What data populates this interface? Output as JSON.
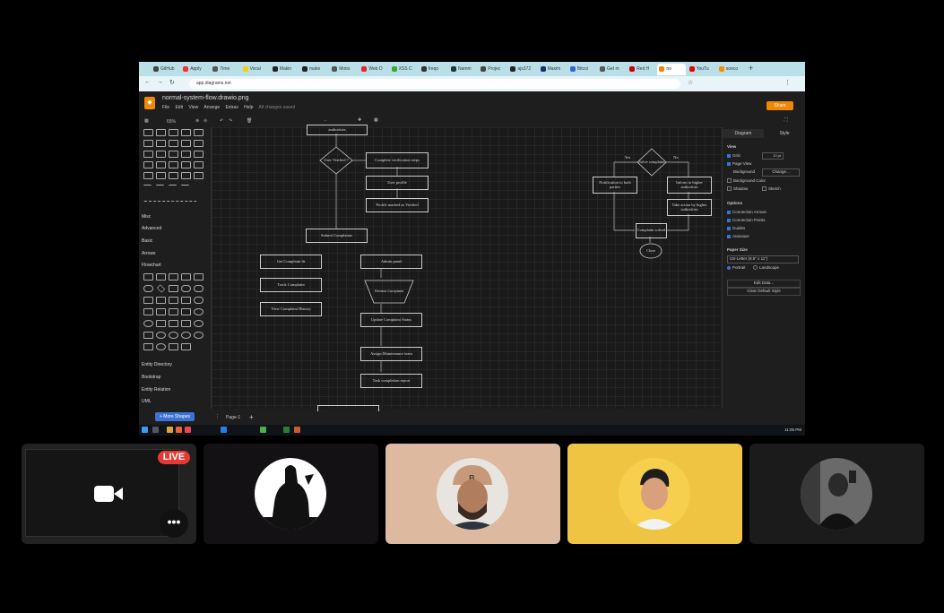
{
  "browser": {
    "tabs": [
      {
        "label": "GitHub",
        "color": "#444"
      },
      {
        "label": "Apply",
        "color": "#e33"
      },
      {
        "label": "Time",
        "color": "#555"
      },
      {
        "label": "Vocal",
        "color": "#fc0"
      },
      {
        "label": "Makin",
        "color": "#222"
      },
      {
        "label": "make",
        "color": "#222"
      },
      {
        "label": "Motio",
        "color": "#555"
      },
      {
        "label": "Web D",
        "color": "#e22"
      },
      {
        "label": "XSS C",
        "color": "#3a3"
      },
      {
        "label": "freqo",
        "color": "#333"
      },
      {
        "label": "Namm",
        "color": "#234"
      },
      {
        "label": "Projec",
        "color": "#444"
      },
      {
        "label": "ajs372",
        "color": "#222"
      },
      {
        "label": "Maxim",
        "color": "#136"
      },
      {
        "label": "Bitcoi",
        "color": "#36c"
      },
      {
        "label": "Get m",
        "color": "#555"
      },
      {
        "label": "Red H",
        "color": "#c00"
      },
      {
        "label": "no",
        "color": "#f08705"
      },
      {
        "label": "YouTu",
        "color": "#e00"
      },
      {
        "label": "soeco",
        "color": "#f80"
      }
    ],
    "url": "app.diagrams.net"
  },
  "app": {
    "filename": "normal-system-flow.drawio.png",
    "menus": [
      "File",
      "Edit",
      "View",
      "Arrange",
      "Extras",
      "Help"
    ],
    "status": "All changes saved",
    "share_label": "Share",
    "zoom": "65%"
  },
  "left_panel": {
    "categories": [
      "Misc",
      "Advanced",
      "Basic",
      "Arrows",
      "Flowchart",
      "Entity Directory",
      "Bootstrap",
      "Entity Relation",
      "UML"
    ],
    "more_shapes": "+ More Shapes"
  },
  "diagram": {
    "nodes": {
      "authorities_top": "authorities",
      "user_verified": "User Verified ?",
      "complete_verification": "Complete verification steps",
      "user_profile": "User profile",
      "profile_verified": "Profile marked as Verified",
      "submit": "Submit Complaints",
      "get_list": "Get Complaint lit",
      "admin_panel": "Admin panel",
      "track": "Track Complaint",
      "review": "Review Complaint",
      "history": "View Complaint History",
      "update_status": "Update Complaint Status",
      "assign": "Assign Maintenance team",
      "task_report": "Task completion report",
      "solve": "Solve complaint",
      "yes": "Yes",
      "no": "No",
      "notify": "Notification to both parties",
      "inform": "Inform to higher authorities",
      "take_action": "Take action by higher authorities",
      "solved": "Complaint solved",
      "close": "Close"
    }
  },
  "right_panel": {
    "tabs": [
      "Diagram",
      "Style"
    ],
    "view_title": "View",
    "grid": "Grid",
    "grid_size": "10 pt",
    "page_view": "Page View",
    "background": "Background",
    "change": "Change...",
    "background_color": "Background Color",
    "shadow": "Shadow",
    "sketch": "Sketch",
    "options_title": "Options",
    "connection_arrows": "Connection Arrows",
    "connection_points": "Connection Points",
    "guides": "Guides",
    "autosave": "Autosave",
    "paper_title": "Paper Size",
    "paper_value": "US-Letter (8.5\" x 11\")",
    "portrait": "Portrait",
    "landscape": "Landscape",
    "edit_data": "Edit Data...",
    "clear_style": "Clear Default Style"
  },
  "page_bar": {
    "page_label": "Page-1"
  },
  "taskbar": {
    "clock": "11:05 PM"
  },
  "meeting": {
    "live_label": "LIVE",
    "tiles": [
      {
        "name": "presenter-tile",
        "bg": "#1c1c1c"
      },
      {
        "name": "participant-tile-1",
        "bg": "#141114"
      },
      {
        "name": "participant-tile-2",
        "bg": "#ddb9a0"
      },
      {
        "name": "participant-tile-3",
        "bg": "#f0c443"
      },
      {
        "name": "participant-tile-4",
        "bg": "#1b1b1b"
      }
    ]
  }
}
